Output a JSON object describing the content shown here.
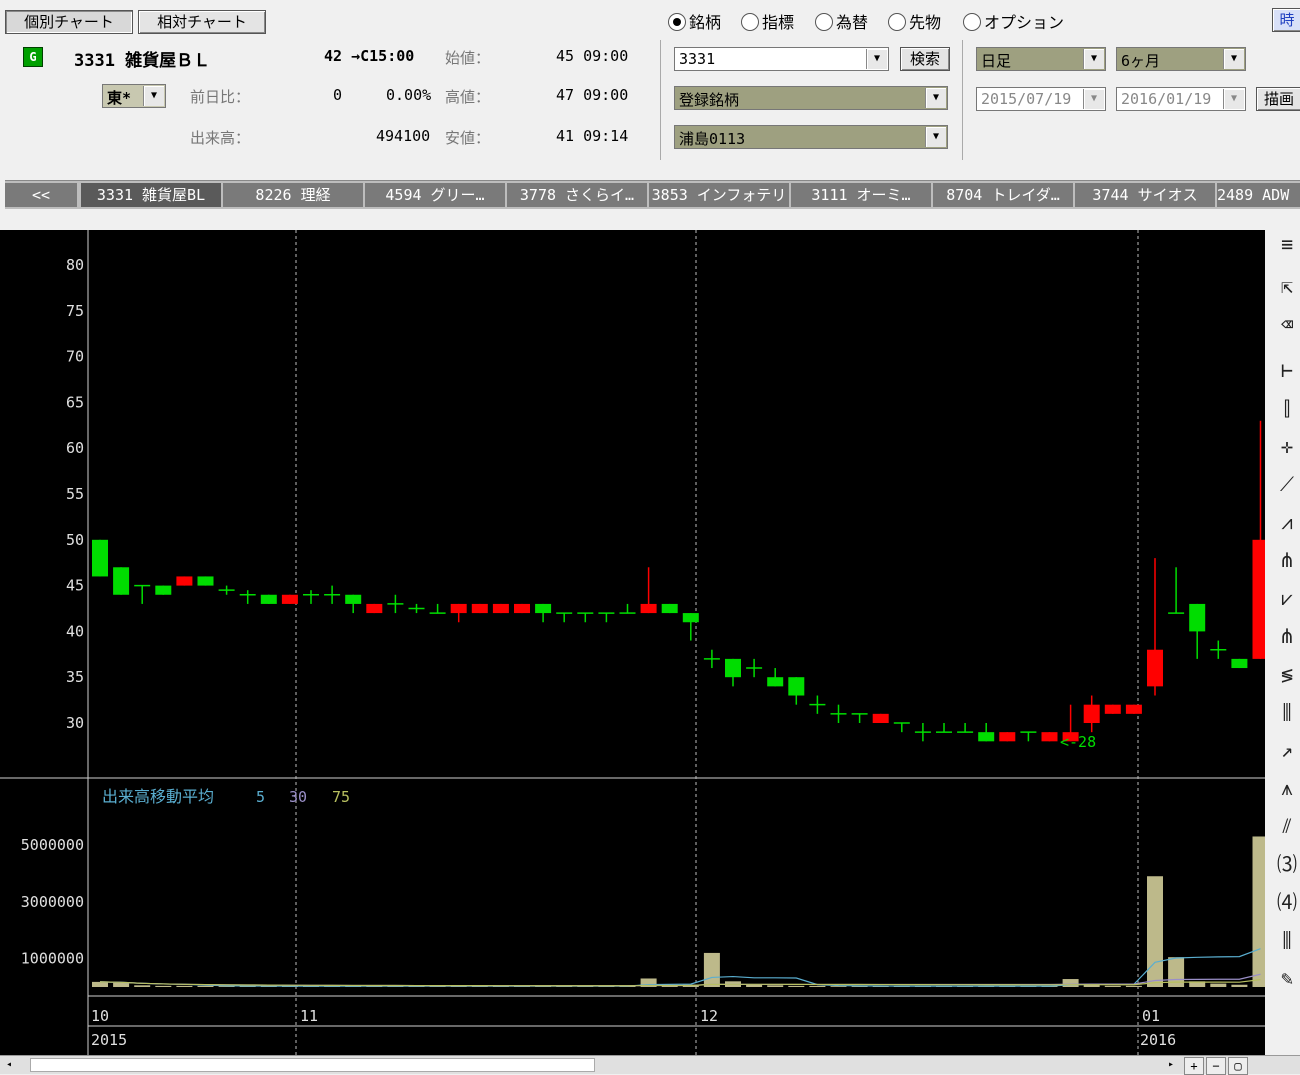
{
  "top_buttons": {
    "individual": "個別チャート",
    "relative": "相対チャート"
  },
  "stock": {
    "badge": "G",
    "code_name": "3331 雑貨屋ＢＬ",
    "price_time": "42 →C15:00",
    "market": "東*",
    "labels": {
      "open": "始値：",
      "high": "高値：",
      "low": "安値：",
      "change": "前日比：",
      "volume": "出来高："
    },
    "open": "45 09:00",
    "high": "47 09:00",
    "low": "41 09:14",
    "change": "0",
    "change_pct": "0.00%",
    "volume": "494100"
  },
  "mode_radios": [
    {
      "label": "銘柄",
      "checked": true
    },
    {
      "label": "指標",
      "checked": false
    },
    {
      "label": "為替",
      "checked": false
    },
    {
      "label": "先物",
      "checked": false
    },
    {
      "label": "オプション",
      "checked": false
    }
  ],
  "search": {
    "code": "3331",
    "button": "検索",
    "list": "登録銘柄",
    "group": "浦島0113"
  },
  "period": {
    "type": "日足",
    "span": "6ヶ月",
    "from": "2015/07/19",
    "to": "2016/01/19",
    "draw_button": "描画",
    "corner_button": "時"
  },
  "tabs": {
    "back": "<<",
    "items": [
      "3331 雑貨屋BL",
      "8226 理経",
      "4594 グリー…",
      "3778 さくらイ…",
      "3853 インフォテリ",
      "3111 オーミ…",
      "8704 トレイダ…",
      "3744 サイオス",
      "2489 ADW"
    ]
  },
  "volume_legend": {
    "title": "出来高移動平均",
    "p1": "5",
    "p2": "30",
    "p3": "75"
  },
  "x_axis": {
    "months": [
      "10",
      "11",
      "12",
      "01"
    ],
    "years": [
      "2015",
      "2016"
    ]
  },
  "annotation": "<-28",
  "colors": {
    "up": "#ff0000",
    "down": "#00dd00",
    "volume": "#bdb98a",
    "ma_short": "#5aaed0",
    "ma_mid": "#9a8fc8",
    "ma_long": "#b8c060",
    "chart_bg": "#000000"
  },
  "chart_data": {
    "type": "candlestick",
    "price_axis": {
      "ticks": [
        80,
        75,
        70,
        65,
        60,
        55,
        50,
        45,
        40,
        35,
        30
      ],
      "range": [
        24,
        82
      ]
    },
    "volume_axis": {
      "ticks": [
        5000000,
        3000000,
        1000000
      ],
      "range": [
        0,
        5600000
      ]
    },
    "candles": [
      {
        "o": 50,
        "h": 50,
        "l": 46,
        "c": 46
      },
      {
        "o": 47,
        "h": 47,
        "l": 44,
        "c": 44
      },
      {
        "o": 45,
        "h": 45,
        "l": 43,
        "c": 45
      },
      {
        "o": 45,
        "h": 45,
        "l": 44,
        "c": 44
      },
      {
        "o": 45,
        "h": 46,
        "l": 45,
        "c": 46
      },
      {
        "o": 46,
        "h": 46,
        "l": 45,
        "c": 45
      },
      {
        "o": 44.5,
        "h": 45,
        "l": 44,
        "c": 44.5
      },
      {
        "o": 44,
        "h": 44.5,
        "l": 43,
        "c": 44
      },
      {
        "o": 44,
        "h": 44,
        "l": 43,
        "c": 43
      },
      {
        "o": 43,
        "h": 44,
        "l": 43,
        "c": 44
      },
      {
        "o": 44,
        "h": 44.5,
        "l": 43,
        "c": 44
      },
      {
        "o": 44,
        "h": 45,
        "l": 43,
        "c": 44
      },
      {
        "o": 44,
        "h": 44,
        "l": 42,
        "c": 43
      },
      {
        "o": 42,
        "h": 43,
        "l": 42,
        "c": 43
      },
      {
        "o": 43,
        "h": 44,
        "l": 42,
        "c": 43
      },
      {
        "o": 42.5,
        "h": 43,
        "l": 42,
        "c": 42.5
      },
      {
        "o": 42,
        "h": 43,
        "l": 42,
        "c": 42
      },
      {
        "o": 42,
        "h": 43,
        "l": 41,
        "c": 43
      },
      {
        "o": 42,
        "h": 43,
        "l": 42,
        "c": 43
      },
      {
        "o": 42,
        "h": 43,
        "l": 42,
        "c": 43
      },
      {
        "o": 42,
        "h": 43,
        "l": 42,
        "c": 43
      },
      {
        "o": 43,
        "h": 43,
        "l": 41,
        "c": 42
      },
      {
        "o": 42,
        "h": 42,
        "l": 41,
        "c": 42
      },
      {
        "o": 42,
        "h": 42,
        "l": 41,
        "c": 42
      },
      {
        "o": 42,
        "h": 42,
        "l": 41,
        "c": 42
      },
      {
        "o": 42,
        "h": 43,
        "l": 42,
        "c": 42
      },
      {
        "o": 42,
        "h": 47,
        "l": 42,
        "c": 43
      },
      {
        "o": 43,
        "h": 43,
        "l": 42,
        "c": 42
      },
      {
        "o": 42,
        "h": 42,
        "l": 39,
        "c": 41
      },
      {
        "o": 37,
        "h": 38,
        "l": 36,
        "c": 37
      },
      {
        "o": 37,
        "h": 37,
        "l": 34,
        "c": 35
      },
      {
        "o": 36,
        "h": 37,
        "l": 35,
        "c": 36
      },
      {
        "o": 35,
        "h": 36,
        "l": 34,
        "c": 34
      },
      {
        "o": 35,
        "h": 35,
        "l": 32,
        "c": 33
      },
      {
        "o": 32,
        "h": 33,
        "l": 31,
        "c": 32
      },
      {
        "o": 31,
        "h": 32,
        "l": 30,
        "c": 31
      },
      {
        "o": 31,
        "h": 31,
        "l": 30,
        "c": 31
      },
      {
        "o": 30,
        "h": 31,
        "l": 30,
        "c": 31
      },
      {
        "o": 30,
        "h": 30,
        "l": 29,
        "c": 30
      },
      {
        "o": 29,
        "h": 30,
        "l": 28,
        "c": 29
      },
      {
        "o": 29,
        "h": 30,
        "l": 29,
        "c": 29
      },
      {
        "o": 29,
        "h": 30,
        "l": 29,
        "c": 29
      },
      {
        "o": 29,
        "h": 30,
        "l": 28,
        "c": 28
      },
      {
        "o": 28,
        "h": 29,
        "l": 28,
        "c": 29
      },
      {
        "o": 29,
        "h": 29,
        "l": 28,
        "c": 29
      },
      {
        "o": 28,
        "h": 29,
        "l": 28,
        "c": 29
      },
      {
        "o": 28,
        "h": 32,
        "l": 28,
        "c": 29
      },
      {
        "o": 30,
        "h": 33,
        "l": 29,
        "c": 32
      },
      {
        "o": 31,
        "h": 32,
        "l": 31,
        "c": 32
      },
      {
        "o": 31,
        "h": 32,
        "l": 31,
        "c": 32
      },
      {
        "o": 34,
        "h": 48,
        "l": 33,
        "c": 38
      },
      {
        "o": 42,
        "h": 47,
        "l": 42,
        "c": 42
      },
      {
        "o": 43,
        "h": 43,
        "l": 37,
        "c": 40
      },
      {
        "o": 38,
        "h": 39,
        "l": 37,
        "c": 38
      },
      {
        "o": 37,
        "h": 37,
        "l": 36,
        "c": 36
      },
      {
        "o": 37,
        "h": 63,
        "l": 37,
        "c": 50
      }
    ],
    "volume": [
      180000,
      150000,
      60000,
      40000,
      40000,
      40000,
      30000,
      30000,
      30000,
      30000,
      30000,
      30000,
      30000,
      30000,
      30000,
      30000,
      30000,
      30000,
      30000,
      30000,
      30000,
      30000,
      30000,
      30000,
      30000,
      40000,
      300000,
      60000,
      80000,
      1200000,
      200000,
      80000,
      60000,
      40000,
      40000,
      30000,
      30000,
      30000,
      30000,
      30000,
      30000,
      30000,
      30000,
      30000,
      30000,
      30000,
      280000,
      80000,
      40000,
      40000,
      3900000,
      1050000,
      200000,
      120000,
      80000,
      5300000
    ]
  }
}
